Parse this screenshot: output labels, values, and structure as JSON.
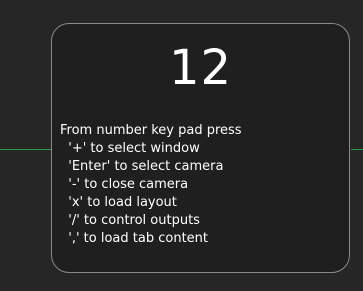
{
  "overlay": {
    "window_number": "12",
    "intro": "From number key pad press",
    "instructions": [
      "  '+' to select window",
      "  'Enter' to select camera",
      "  '-' to close camera",
      "  'x' to load layout",
      "  '/' to control outputs",
      "  ',' to load tab content"
    ]
  },
  "colors": {
    "background": "#262626",
    "card_border": "#8a8a8a",
    "text": "#ffffff",
    "guide_line": "#2fa84f"
  }
}
